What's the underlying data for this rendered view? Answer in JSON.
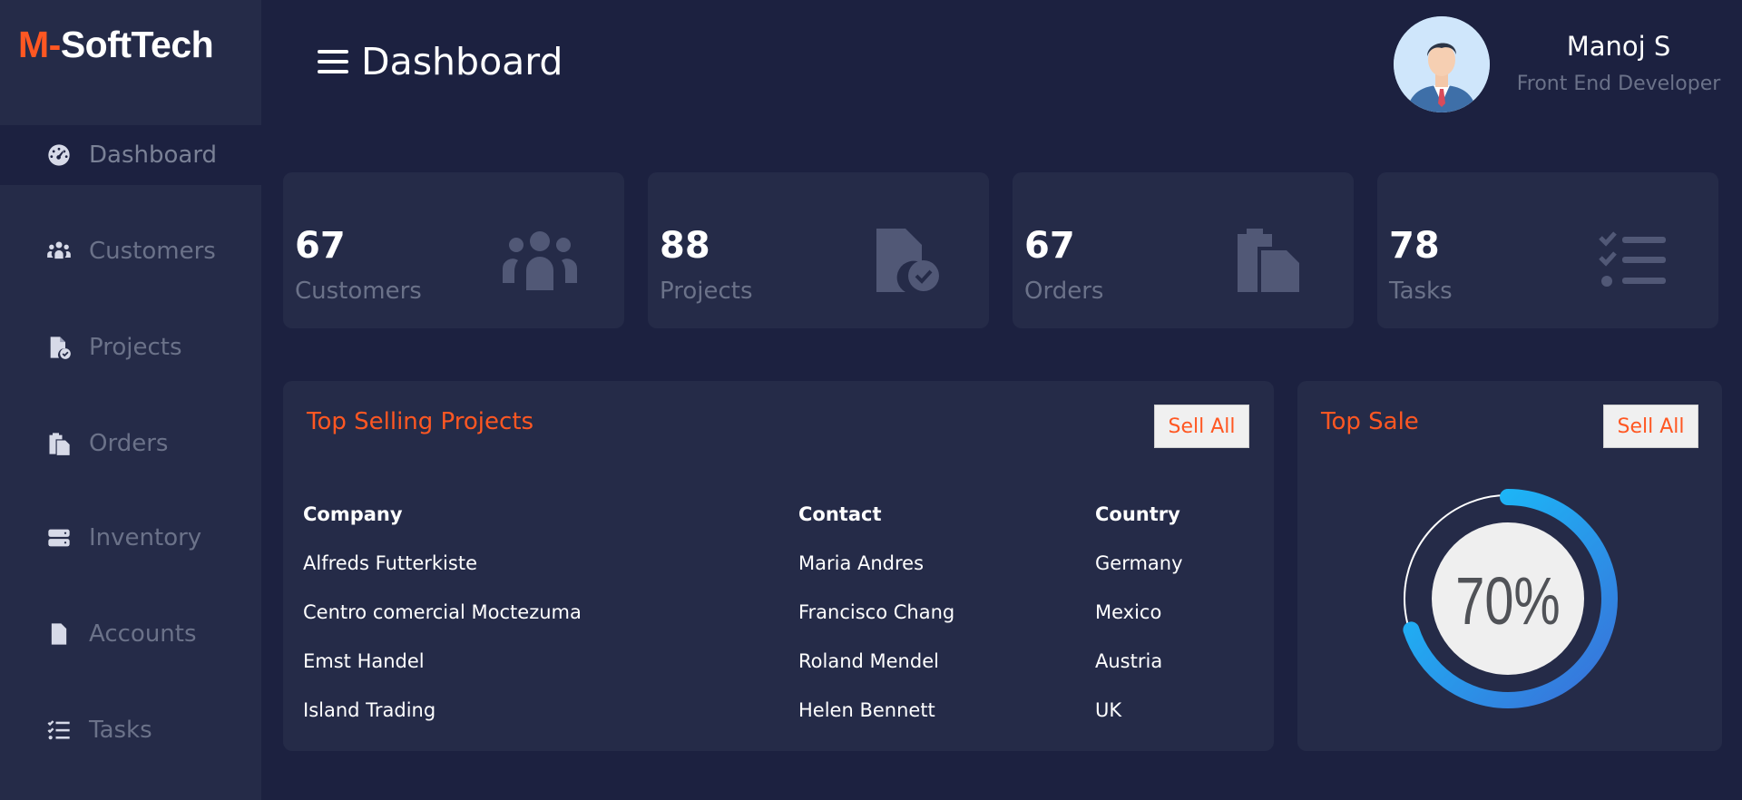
{
  "brand": {
    "accent": "M-",
    "rest": "SoftTech"
  },
  "sidebar": {
    "items": [
      {
        "label": "Dashboard",
        "icon": "gauge-icon",
        "active": true
      },
      {
        "label": "Customers",
        "icon": "users-icon"
      },
      {
        "label": "Projects",
        "icon": "file-check-icon"
      },
      {
        "label": "Orders",
        "icon": "clipboard-icon"
      },
      {
        "label": "Inventory",
        "icon": "server-icon"
      },
      {
        "label": "Accounts",
        "icon": "file-icon"
      },
      {
        "label": "Tasks",
        "icon": "checklist-icon"
      }
    ]
  },
  "header": {
    "title": "Dashboard"
  },
  "user": {
    "name": "Manoj S",
    "role": "Front End Developer"
  },
  "cards": [
    {
      "value": "67",
      "label": "Customers",
      "icon": "users-icon"
    },
    {
      "value": "88",
      "label": "Projects",
      "icon": "file-check-icon"
    },
    {
      "value": "67",
      "label": "Orders",
      "icon": "clipboard-icon"
    },
    {
      "value": "78",
      "label": "Tasks",
      "icon": "checklist-icon"
    }
  ],
  "top_projects": {
    "title": "Top Selling Projects",
    "button": "Sell All",
    "columns": [
      "Company",
      "Contact",
      "Country"
    ],
    "rows": [
      [
        "Alfreds Futterkiste",
        "Maria Andres",
        "Germany"
      ],
      [
        "Centro comercial Moctezuma",
        "Francisco Chang",
        "Mexico"
      ],
      [
        "Emst Handel",
        "Roland Mendel",
        "Austria"
      ],
      [
        "Island Trading",
        "Helen Bennett",
        "UK"
      ]
    ]
  },
  "top_sale": {
    "title": "Top Sale",
    "button": "Sell All",
    "percent_label": "70%",
    "percent": 70
  },
  "colors": {
    "accent": "#ff5722",
    "background": "#1c2140",
    "panel": "#252b48",
    "muted": "#6b7289",
    "gauge_start": "#3a6fd8",
    "gauge_end": "#14c9ff"
  }
}
